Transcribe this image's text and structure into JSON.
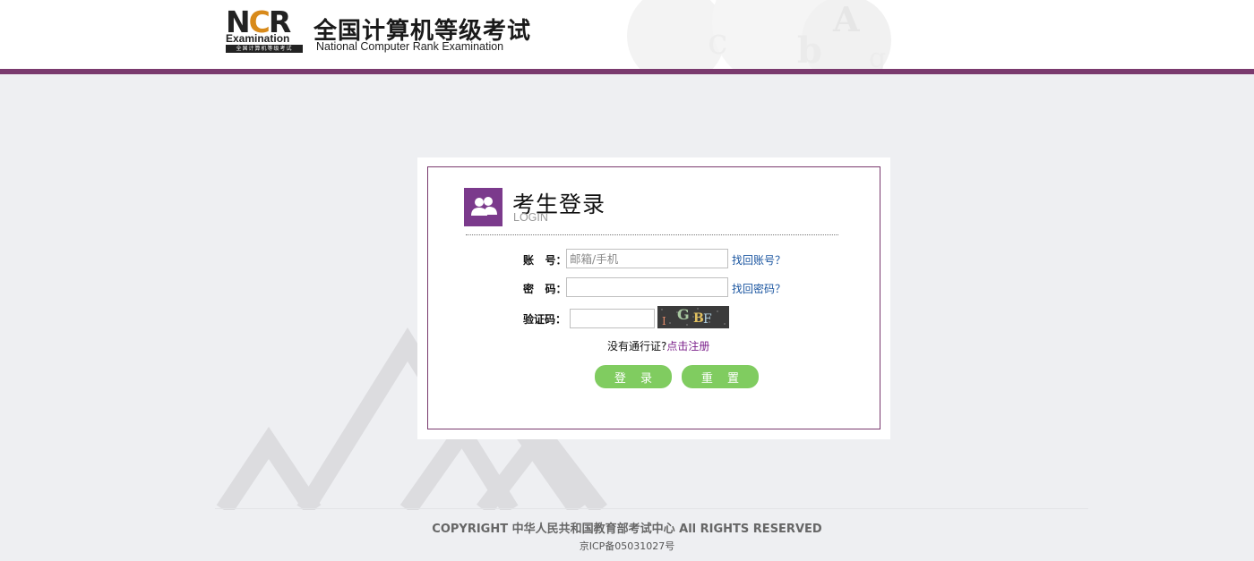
{
  "header": {
    "logo_letters_n": "N",
    "logo_letters_c": "C",
    "logo_letters_r": "R",
    "logo_examination": "Examination",
    "logo_bar_text": "全国计算机等级考试",
    "brand_cn": "全国计算机等级考试",
    "brand_en": "National Computer Rank Examination"
  },
  "login": {
    "title": "考生登录",
    "subtitle": "LOGIN",
    "account_label": "账   号：",
    "account_placeholder": "邮箱/手机",
    "account_value": "",
    "find_account": "找回账号？",
    "password_label": "密   码：",
    "password_value": "",
    "find_password": "找回密码？",
    "captcha_label": "验证码：",
    "captcha_value": "",
    "captcha_text": "IGBF",
    "no_pass_text": "没有通行证?",
    "register_link": "点击注册",
    "login_button": "登 录",
    "reset_button": "重 置"
  },
  "footer": {
    "copyright": "COPYRIGHT 中华人民共和国教育部考试中心 All RIGHTS RESERVED",
    "icp": "京ICP备05031027号"
  },
  "colors": {
    "accent": "#7a3a6e",
    "icon_bg": "#7b3a8c",
    "button": "#80cc60",
    "link": "#1a55a0",
    "register": "#7b1f8a"
  }
}
